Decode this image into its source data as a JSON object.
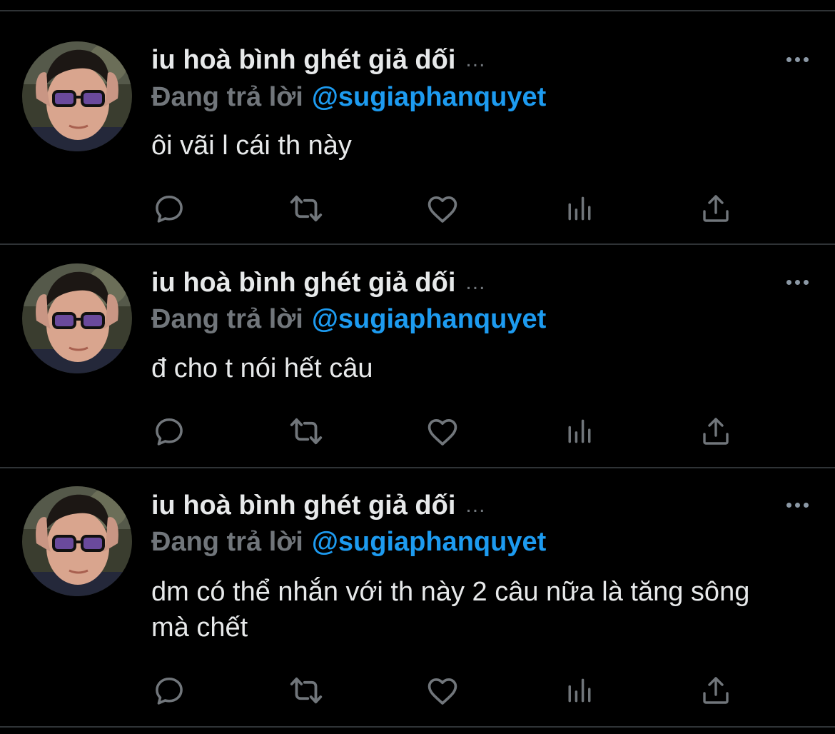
{
  "tweets": [
    {
      "author_name": "iu hoà bình ghét giả dối",
      "name_ellipsis": "...",
      "reply_prefix": "Đang trả lời",
      "reply_handle": "@sugiaphanquyet",
      "text": "ôi vãi l cái th này"
    },
    {
      "author_name": "iu hoà bình ghét giả dối",
      "name_ellipsis": "...",
      "reply_prefix": "Đang trả lời",
      "reply_handle": "@sugiaphanquyet",
      "text": "đ cho t nói hết câu"
    },
    {
      "author_name": "iu hoà bình ghét giả dối",
      "name_ellipsis": "...",
      "reply_prefix": "Đang trả lời",
      "reply_handle": "@sugiaphanquyet",
      "text": "dm có thể nhắn với th này 2 câu nữa là tăng sông mà chết"
    }
  ],
  "icons": {
    "reply": "reply-icon",
    "retweet": "retweet-icon",
    "like": "heart-icon",
    "views": "views-icon",
    "share": "share-icon",
    "more": "more-icon"
  },
  "colors": {
    "background": "#000000",
    "text": "#e7e9ea",
    "muted": "#71767b",
    "link": "#1d9bf0",
    "divider": "#2f3336"
  }
}
